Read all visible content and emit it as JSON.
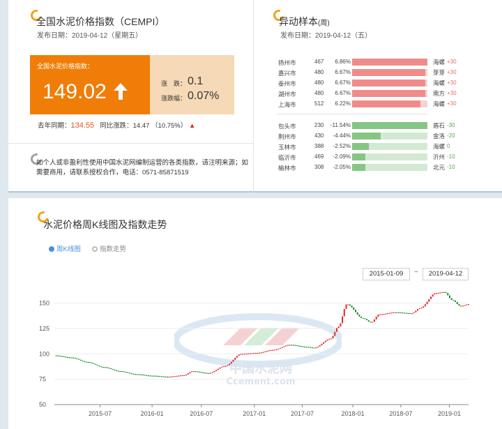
{
  "cempi": {
    "title": "全国水泥价格指数（CEMPI）",
    "publish_date": "发布日期：2019-04-12（星期五）",
    "box_label": "全国水泥价格指数：",
    "value": "149.02",
    "change_label": "涨　跌：",
    "change_value": "0.1",
    "pct_label": "涨跌幅：",
    "pct_value": "0.07%",
    "yoy_label": "去年同期：",
    "yoy_value": "134.55",
    "yoy_diff_label": "同比涨跌：",
    "yoy_diff_value": "14.47",
    "yoy_pct": "（10.75%）",
    "notice": "如个人或非盈利性使用中国水泥网编制运营的各类指数，请注明来源；如需要商用，请联系授权合作，电话：0571-85871519"
  },
  "samples": {
    "title": "异动样本",
    "title_suffix": "(周)",
    "publish_date": "发布日期：2019-04-12（五）",
    "up": [
      {
        "city": "扬州市",
        "num": "467",
        "pct": "6.86%",
        "fill": 1.0,
        "brand": "海螺",
        "delta": "+30"
      },
      {
        "city": "嘉兴市",
        "num": "480",
        "pct": "6.67%",
        "fill": 0.97,
        "brand": "芽芽",
        "delta": "+30"
      },
      {
        "city": "泰州市",
        "num": "480",
        "pct": "6.67%",
        "fill": 0.97,
        "brand": "海螺",
        "delta": "+30"
      },
      {
        "city": "湖州市",
        "num": "480",
        "pct": "6.67%",
        "fill": 0.97,
        "brand": "南方",
        "delta": "+30"
      },
      {
        "city": "上海市",
        "num": "512",
        "pct": "6.22%",
        "fill": 0.91,
        "brand": "海螺",
        "delta": "+30"
      }
    ],
    "down": [
      {
        "city": "包头市",
        "num": "230",
        "pct": "-11.54%",
        "fill": 1.0,
        "brand": "盾石",
        "delta": "-30"
      },
      {
        "city": "荆州市",
        "num": "430",
        "pct": "-4.44%",
        "fill": 0.38,
        "brand": "金洛",
        "delta": "-20"
      },
      {
        "city": "玉林市",
        "num": "388",
        "pct": "-2.52%",
        "fill": 0.22,
        "brand": "海螺",
        "delta": "0"
      },
      {
        "city": "临沂市",
        "num": "469",
        "pct": "-2.09%",
        "fill": 0.18,
        "brand": "沂州",
        "delta": "-10"
      },
      {
        "city": "榆林市",
        "num": "308",
        "pct": "-2.05%",
        "fill": 0.18,
        "brand": "北元",
        "delta": "-10"
      }
    ]
  },
  "trend": {
    "title": "水泥价格周K线图及指数走势",
    "tabs": [
      {
        "label": "周K线图",
        "active": true
      },
      {
        "label": "指数走势",
        "active": false
      }
    ],
    "date_from": "2015-01-09",
    "separator": "~",
    "date_to": "2019-04-12"
  },
  "watermark": {
    "cn": "中国水泥网",
    "en": "Ccement.com"
  },
  "chart_data": {
    "type": "candlestick",
    "title": "水泥价格周K线图及指数走势",
    "x_tick_labels": [
      "2015-07",
      "2016-01",
      "2016-07",
      "2017-01",
      "2017-07",
      "2018-01",
      "2018-07",
      "2019-01"
    ],
    "x_tick_fractions": [
      0.1104,
      0.2359,
      0.3549,
      0.4828,
      0.5985,
      0.7207,
      0.8365,
      0.9537
    ],
    "y_ticks": [
      50,
      75,
      100,
      125,
      150
    ],
    "ylim": [
      50,
      160
    ],
    "up_color": "#e0282a",
    "down_color": "#1a8a2a",
    "points": [
      {
        "x": "2015-01",
        "y": 98.5
      },
      {
        "x": "2015-03",
        "y": 96.5
      },
      {
        "x": "2015-05",
        "y": 92
      },
      {
        "x": "2015-07",
        "y": 87
      },
      {
        "x": "2015-09",
        "y": 83
      },
      {
        "x": "2015-11",
        "y": 80
      },
      {
        "x": "2016-01",
        "y": 78.5
      },
      {
        "x": "2016-03",
        "y": 77.5
      },
      {
        "x": "2016-05",
        "y": 79
      },
      {
        "x": "2016-06",
        "y": 83
      },
      {
        "x": "2016-08",
        "y": 81
      },
      {
        "x": "2016-10",
        "y": 88
      },
      {
        "x": "2016-12",
        "y": 100
      },
      {
        "x": "2017-02",
        "y": 101
      },
      {
        "x": "2017-04",
        "y": 104
      },
      {
        "x": "2017-06",
        "y": 109
      },
      {
        "x": "2017-08",
        "y": 107
      },
      {
        "x": "2017-09",
        "y": 106
      },
      {
        "x": "2017-11",
        "y": 115
      },
      {
        "x": "2017-12",
        "y": 127
      },
      {
        "x": "2018-01",
        "y": 149
      },
      {
        "x": "2018-03",
        "y": 135
      },
      {
        "x": "2018-04",
        "y": 131
      },
      {
        "x": "2018-05",
        "y": 139
      },
      {
        "x": "2018-07",
        "y": 141
      },
      {
        "x": "2018-09",
        "y": 140
      },
      {
        "x": "2018-10",
        "y": 145
      },
      {
        "x": "2018-12",
        "y": 160
      },
      {
        "x": "2019-01",
        "y": 161
      },
      {
        "x": "2019-02",
        "y": 153
      },
      {
        "x": "2019-03",
        "y": 147
      },
      {
        "x": "2019-04",
        "y": 149
      }
    ]
  }
}
